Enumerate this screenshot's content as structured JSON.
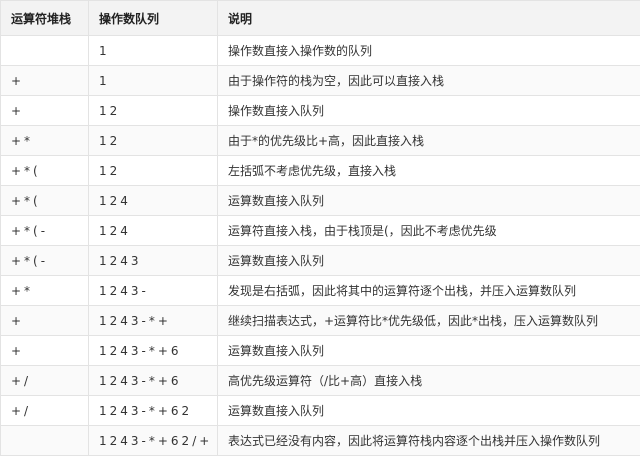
{
  "table": {
    "headers": [
      "运算符堆栈",
      "操作数队列",
      "说明"
    ],
    "rows": [
      {
        "stack": "",
        "queue": "1",
        "desc": "操作数直接入操作数的队列"
      },
      {
        "stack": "+",
        "queue": "1",
        "desc": "由于操作符的栈为空，因此可以直接入栈"
      },
      {
        "stack": "+",
        "queue": "12",
        "desc": "操作数直接入队列"
      },
      {
        "stack": "+*",
        "queue": "12",
        "desc": "由于*的优先级比+高，因此直接入栈"
      },
      {
        "stack": "+*(",
        "queue": "12",
        "desc": "左括弧不考虑优先级，直接入栈"
      },
      {
        "stack": "+*(",
        "queue": "124",
        "desc": "运算数直接入队列"
      },
      {
        "stack": "+*(-",
        "queue": "124",
        "desc": "运算符直接入栈，由于栈顶是(，因此不考虑优先级"
      },
      {
        "stack": "+*(-",
        "queue": "1243",
        "desc": "运算数直接入队列"
      },
      {
        "stack": "+*",
        "queue": "1243-",
        "desc": "发现是右括弧，因此将其中的运算符逐个出栈，并压入运算数队列"
      },
      {
        "stack": "+",
        "queue": "1243-*+",
        "desc": "继续扫描表达式，+运算符比*优先级低，因此*出栈，压入运算数队列"
      },
      {
        "stack": "+",
        "queue": "1243-*+6",
        "desc": "运算数直接入队列"
      },
      {
        "stack": "+/",
        "queue": "1243-*+6",
        "desc": "高优先级运算符（/比+高）直接入栈"
      },
      {
        "stack": "+/",
        "queue": "1243-*+62",
        "desc": "运算数直接入队列"
      },
      {
        "stack": "",
        "queue": "1243-*+62/+",
        "desc": "表达式已经没有内容，因此将运算符栈内容逐个出栈并压入操作数队列"
      }
    ]
  }
}
